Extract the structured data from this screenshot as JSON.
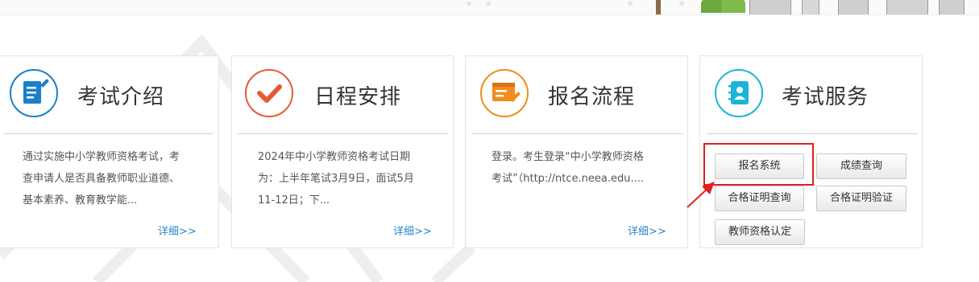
{
  "cards": [
    {
      "title": "考试介绍",
      "icon": "document-edit-icon",
      "accent": "#1a7fc9",
      "desc": [
        "通过实施中小学教师资格考试，考",
        "查申请人是否具备教师职业道德、",
        "基本素养、教育教学能..."
      ],
      "more": "详细>>"
    },
    {
      "title": "日程安排",
      "icon": "checkmark-icon",
      "accent": "#e45b33",
      "desc": [
        "2024年中小学教师资格考试日期",
        "为：上半年笔试3月9日，面试5月",
        "11-12日；下..."
      ],
      "more": "详细>>"
    },
    {
      "title": "报名流程",
      "icon": "registration-form-icon",
      "accent": "#f08d1e",
      "desc": [
        "登录。考生登录“中小学教师资格",
        "考试”（http://ntce.neea.edu...."
      ],
      "more": "详细>>"
    },
    {
      "title": "考试服务",
      "icon": "contact-book-icon",
      "accent": "#1bb5d8",
      "buttons": [
        "报名系统",
        "成绩查询",
        "合格证明查询",
        "合格证明验证",
        "教师资格认定"
      ]
    }
  ],
  "colors": {
    "highlight": "#e02020",
    "link": "#2a88c8"
  }
}
